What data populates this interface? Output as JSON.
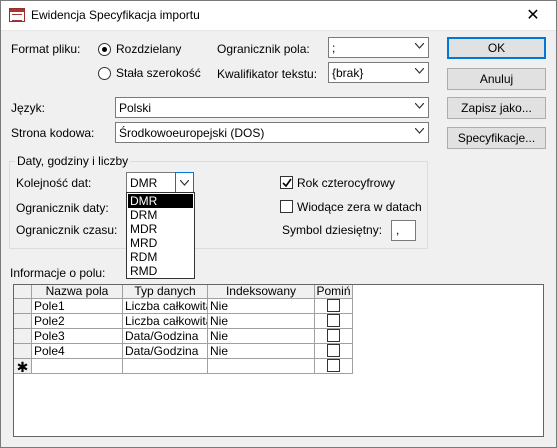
{
  "window": {
    "title": "Ewidencja Specyfikacja importu",
    "close_glyph": "✕"
  },
  "format": {
    "label": "Format pliku:",
    "options": [
      "Rozdzielany",
      "Stała szerokość"
    ],
    "selected": "Rozdzielany"
  },
  "field_delimiter": {
    "label": "Ogranicznik pola:",
    "value": ";"
  },
  "text_qualifier": {
    "label": "Kwalifikator tekstu:",
    "value": "{brak}"
  },
  "language": {
    "label": "Język:",
    "value": "Polski"
  },
  "codepage": {
    "label": "Strona kodowa:",
    "value": "Środkowoeuropejski (DOS)"
  },
  "buttons": {
    "ok": "OK",
    "cancel": "Anuluj",
    "save_as": "Zapisz jako...",
    "specs": "Specyfikacje..."
  },
  "dates_group": {
    "title": "Daty, godziny i liczby",
    "date_order_label": "Kolejność dat:",
    "date_order_value": "DMR",
    "date_order_options": [
      "DMR",
      "DRM",
      "MDR",
      "MRD",
      "RDM",
      "RMD"
    ],
    "date_delimiter_label": "Ogranicznik daty:",
    "time_delimiter_label": "Ogranicznik czasu:",
    "four_digit_year_label": "Rok czterocyfrowy",
    "four_digit_year_checked": true,
    "leading_zeros_label": "Wiodące zera w datach",
    "leading_zeros_checked": false,
    "decimal_symbol_label": "Symbol dziesiętny:",
    "decimal_symbol_value": ","
  },
  "field_info": {
    "label": "Informacje o polu:",
    "columns": [
      "Nazwa pola",
      "Typ danych",
      "Indeksowany",
      "Pomiń"
    ],
    "rows": [
      {
        "name": "Pole1",
        "type": "Liczba całkowita dł",
        "indexed": "Nie",
        "skip": false
      },
      {
        "name": "Pole2",
        "type": "Liczba całkowita dł",
        "indexed": "Nie",
        "skip": false
      },
      {
        "name": "Pole3",
        "type": "Data/Godzina",
        "indexed": "Nie",
        "skip": false
      },
      {
        "name": "Pole4",
        "type": "Data/Godzina",
        "indexed": "Nie",
        "skip": false
      }
    ],
    "new_row_marker": "✱"
  }
}
